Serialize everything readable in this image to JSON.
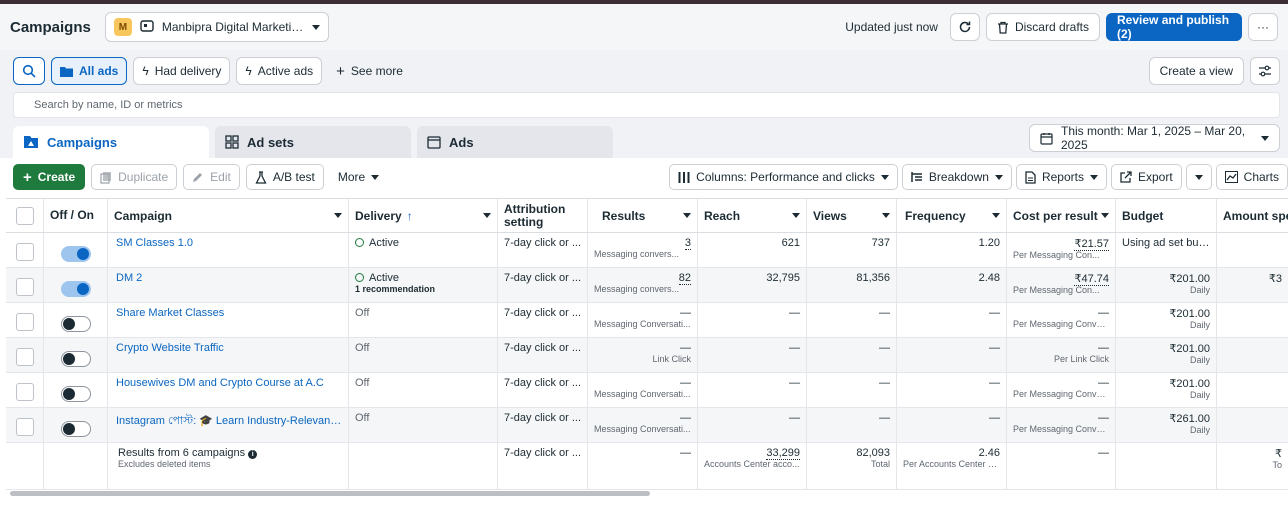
{
  "header": {
    "title": "Campaigns",
    "account_badge": "M",
    "account_name": "Manbipra Digital Marketin...",
    "updated": "Updated just now",
    "discard": "Discard drafts",
    "review": "Review and publish (2)",
    "more": "···"
  },
  "filters": {
    "all_ads": "All ads",
    "had_delivery": "Had delivery",
    "active_ads": "Active ads",
    "see_more": "See more",
    "create_view": "Create a view"
  },
  "search": {
    "placeholder": "Search by name, ID or metrics"
  },
  "tabs": {
    "campaigns": "Campaigns",
    "adsets": "Ad sets",
    "ads": "Ads"
  },
  "date_range": "This month: Mar 1, 2025 – Mar 20, 2025",
  "toolbar": {
    "create": "Create",
    "duplicate": "Duplicate",
    "edit": "Edit",
    "ab_test": "A/B test",
    "more": "More",
    "columns": "Columns: Performance and clicks",
    "breakdown": "Breakdown",
    "reports": "Reports",
    "export": "Export",
    "charts": "Charts"
  },
  "columns": {
    "toggle": "Off / On",
    "campaign": "Campaign",
    "delivery": "Delivery",
    "attribution": "Attribution setting",
    "results": "Results",
    "reach": "Reach",
    "views": "Views",
    "frequency": "Frequency",
    "cost": "Cost per result",
    "budget": "Budget",
    "amount": "Amount spe"
  },
  "rows": [
    {
      "name": "SM Classes 1.0",
      "delivery": "Active",
      "rec": "",
      "attr": "7-day click or ...",
      "results": "3",
      "results_sub": "Messaging convers...",
      "reach": "621",
      "views": "737",
      "freq": "1.20",
      "cost": "₹21.57",
      "cost_sub": "Per Messaging Con...",
      "budget": "Using ad set bud...",
      "budget_sub": "",
      "amount": ""
    },
    {
      "name": "DM 2",
      "delivery": "Active",
      "rec": "1 recommendation",
      "attr": "7-day click or ...",
      "results": "82",
      "results_sub": "Messaging convers...",
      "reach": "32,795",
      "views": "81,356",
      "freq": "2.48",
      "cost": "₹47.74",
      "cost_sub": "Per Messaging Con...",
      "budget": "₹201.00",
      "budget_sub": "Daily",
      "amount": "₹3"
    },
    {
      "name": "Share Market Classes",
      "delivery": "Off",
      "rec": "",
      "attr": "7-day click or ...",
      "results": "—",
      "results_sub": "Messaging Conversati...",
      "reach": "—",
      "views": "—",
      "freq": "—",
      "cost": "—",
      "cost_sub": "Per Messaging Conver...",
      "budget": "₹201.00",
      "budget_sub": "Daily",
      "amount": ""
    },
    {
      "name": "Crypto Website Traffic",
      "delivery": "Off",
      "rec": "",
      "attr": "7-day click or ...",
      "results": "—",
      "results_sub": "Link Click",
      "reach": "—",
      "views": "—",
      "freq": "—",
      "cost": "—",
      "cost_sub": "Per Link Click",
      "budget": "₹201.00",
      "budget_sub": "Daily",
      "amount": ""
    },
    {
      "name": "Housewives DM and Crypto Course at A.C",
      "delivery": "Off",
      "rec": "",
      "attr": "7-day click or ...",
      "results": "—",
      "results_sub": "Messaging Conversati...",
      "reach": "—",
      "views": "—",
      "freq": "—",
      "cost": "—",
      "cost_sub": "Per Messaging Conver...",
      "budget": "₹201.00",
      "budget_sub": "Daily",
      "amount": ""
    },
    {
      "name": "Instagram পোস্ট: 🎓 Learn Industry-Relevant S...",
      "delivery": "Off",
      "rec": "",
      "attr": "7-day click or ...",
      "results": "—",
      "results_sub": "Messaging Conversati...",
      "reach": "—",
      "views": "—",
      "freq": "—",
      "cost": "—",
      "cost_sub": "Per Messaging Conver...",
      "budget": "₹261.00",
      "budget_sub": "Daily",
      "amount": ""
    }
  ],
  "totals": {
    "label": "Results from 6 campaigns",
    "sub": "Excludes deleted items",
    "attr": "7-day click or ...",
    "results": "—",
    "reach": "33,299",
    "reach_sub": "Accounts Center acco...",
    "views": "82,093",
    "views_sub": "Total",
    "freq": "2.46",
    "freq_sub": "Per Accounts Center a...",
    "cost": "—",
    "amount": "₹",
    "amount_sub": "To"
  }
}
